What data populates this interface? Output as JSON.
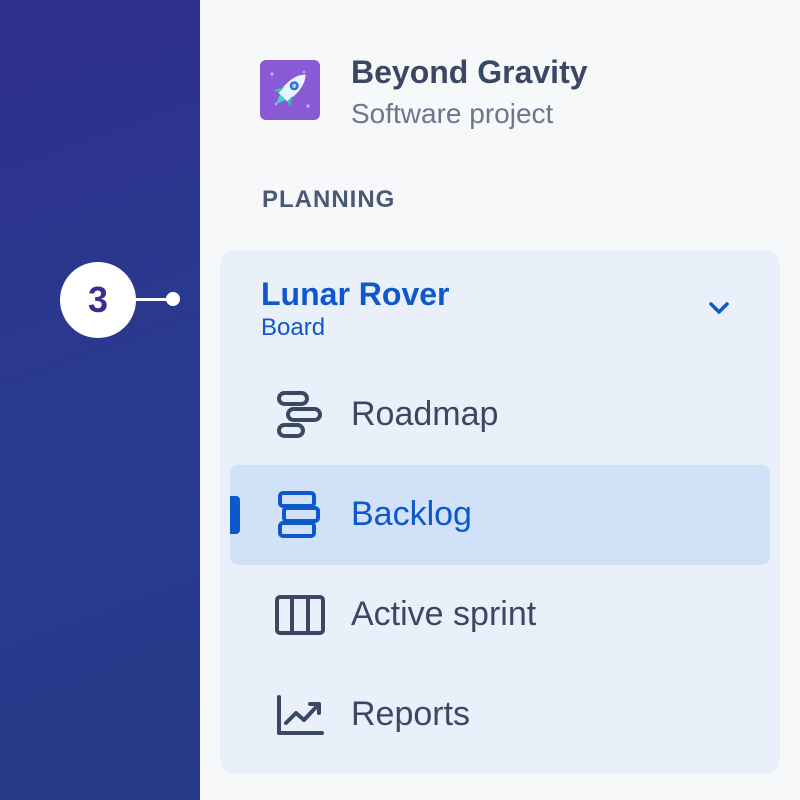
{
  "annotation": {
    "step_number": "3"
  },
  "project": {
    "name": "Beyond Gravity",
    "type": "Software project",
    "icon": "rocket-icon",
    "icon_bg": "#8a5ad6"
  },
  "sidebar": {
    "section_heading": "PLANNING",
    "board": {
      "title": "Lunar Rover",
      "subtitle": "Board",
      "expand_icon": "chevron-down-icon"
    },
    "items": [
      {
        "label": "Roadmap",
        "icon": "roadmap-icon",
        "selected": false
      },
      {
        "label": "Backlog",
        "icon": "backlog-icon",
        "selected": true
      },
      {
        "label": "Active sprint",
        "icon": "board-columns-icon",
        "selected": false
      },
      {
        "label": "Reports",
        "icon": "line-chart-icon",
        "selected": false
      }
    ]
  },
  "colors": {
    "accent": "#0c58cc",
    "text": "#3a4863",
    "selected_bg": "#d0e1f8",
    "card_bg": "#eaf0fa",
    "band": "#2b358c"
  }
}
